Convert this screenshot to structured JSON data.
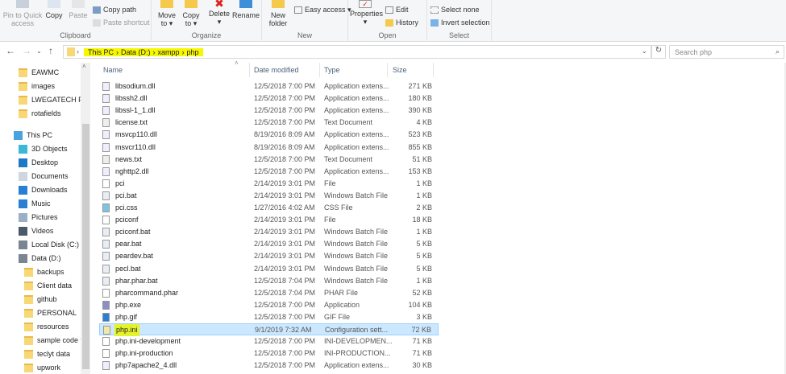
{
  "ribbon": {
    "clipboard": {
      "label": "Clipboard",
      "pin": "Pin to Quick access",
      "copy": "Copy",
      "paste": "Paste",
      "copy_path": "Copy path",
      "paste_shortcut": "Paste shortcut"
    },
    "organize": {
      "label": "Organize",
      "move_to": "Move to",
      "copy_to": "Copy to",
      "delete": "Delete",
      "rename": "Rename"
    },
    "new": {
      "label": "New",
      "new_folder": "New folder",
      "easy_access": "Easy access"
    },
    "open": {
      "label": "Open",
      "properties": "Properties",
      "edit": "Edit",
      "history": "History"
    },
    "select": {
      "label": "Select",
      "select_none": "Select none",
      "invert": "Invert selection"
    }
  },
  "address": {
    "crumbs": [
      "This PC",
      "Data  (D:)",
      "xampp",
      "php"
    ],
    "search_placeholder": "Search php",
    "highlight_color": "#f7f700"
  },
  "sidebar": {
    "items": [
      {
        "label": "EAWMC",
        "icon": "folder-icon",
        "indent": 1
      },
      {
        "label": "images",
        "icon": "folder-icon",
        "indent": 1
      },
      {
        "label": "LWEGATECH PO",
        "icon": "folder-icon",
        "indent": 1
      },
      {
        "label": "rotafields",
        "icon": "folder-icon",
        "indent": 1
      },
      {
        "label": "This PC",
        "icon": "computer-icon",
        "indent": 0
      },
      {
        "label": "3D Objects",
        "icon": "cube-icon",
        "indent": 1
      },
      {
        "label": "Desktop",
        "icon": "desktop-icon",
        "indent": 1
      },
      {
        "label": "Documents",
        "icon": "document-icon",
        "indent": 1
      },
      {
        "label": "Downloads",
        "icon": "download-icon",
        "indent": 1
      },
      {
        "label": "Music",
        "icon": "music-icon",
        "indent": 1
      },
      {
        "label": "Pictures",
        "icon": "pictures-icon",
        "indent": 1
      },
      {
        "label": "Videos",
        "icon": "videos-icon",
        "indent": 1
      },
      {
        "label": "Local Disk (C:)",
        "icon": "drive-icon",
        "indent": 1
      },
      {
        "label": "Data  (D:)",
        "icon": "drive-icon",
        "indent": 1
      },
      {
        "label": "backups",
        "icon": "folder-icon",
        "indent": 2
      },
      {
        "label": "Client data",
        "icon": "folder-icon",
        "indent": 2
      },
      {
        "label": "github",
        "icon": "folder-icon",
        "indent": 2
      },
      {
        "label": "PERSONAL",
        "icon": "folder-icon",
        "indent": 2
      },
      {
        "label": "resources",
        "icon": "folder-icon",
        "indent": 2
      },
      {
        "label": "sample code fc",
        "icon": "folder-icon",
        "indent": 2
      },
      {
        "label": "teclyt data",
        "icon": "folder-icon",
        "indent": 2
      },
      {
        "label": "upwork",
        "icon": "folder-icon",
        "indent": 2
      }
    ]
  },
  "columns": {
    "name": "Name",
    "date": "Date modified",
    "type": "Type",
    "size": "Size"
  },
  "files": [
    {
      "name": "libsodium.dll",
      "date": "12/5/2018 7:00 PM",
      "type": "Application extens...",
      "size": "271 KB",
      "icon": "dll-icon"
    },
    {
      "name": "libssh2.dll",
      "date": "12/5/2018 7:00 PM",
      "type": "Application extens...",
      "size": "180 KB",
      "icon": "dll-icon"
    },
    {
      "name": "libssl-1_1.dll",
      "date": "12/5/2018 7:00 PM",
      "type": "Application extens...",
      "size": "390 KB",
      "icon": "dll-icon"
    },
    {
      "name": "license.txt",
      "date": "12/5/2018 7:00 PM",
      "type": "Text Document",
      "size": "4 KB",
      "icon": "text-icon"
    },
    {
      "name": "msvcp110.dll",
      "date": "8/19/2016 8:09 AM",
      "type": "Application extens...",
      "size": "523 KB",
      "icon": "dll-icon"
    },
    {
      "name": "msvcr110.dll",
      "date": "8/19/2016 8:09 AM",
      "type": "Application extens...",
      "size": "855 KB",
      "icon": "dll-icon"
    },
    {
      "name": "news.txt",
      "date": "12/5/2018 7:00 PM",
      "type": "Text Document",
      "size": "51 KB",
      "icon": "text-icon"
    },
    {
      "name": "nghttp2.dll",
      "date": "12/5/2018 7:00 PM",
      "type": "Application extens...",
      "size": "153 KB",
      "icon": "dll-icon"
    },
    {
      "name": "pci",
      "date": "2/14/2019 3:01 PM",
      "type": "File",
      "size": "1 KB",
      "icon": "file-icon"
    },
    {
      "name": "pci.bat",
      "date": "2/14/2019 3:01 PM",
      "type": "Windows Batch File",
      "size": "1 KB",
      "icon": "batch-icon"
    },
    {
      "name": "pci.css",
      "date": "1/27/2016 4:02 AM",
      "type": "CSS File",
      "size": "2 KB",
      "icon": "css-icon"
    },
    {
      "name": "pciconf",
      "date": "2/14/2019 3:01 PM",
      "type": "File",
      "size": "18 KB",
      "icon": "file-icon"
    },
    {
      "name": "pciconf.bat",
      "date": "2/14/2019 3:01 PM",
      "type": "Windows Batch File",
      "size": "1 KB",
      "icon": "batch-icon"
    },
    {
      "name": "pear.bat",
      "date": "2/14/2019 3:01 PM",
      "type": "Windows Batch File",
      "size": "5 KB",
      "icon": "batch-icon"
    },
    {
      "name": "peardev.bat",
      "date": "2/14/2019 3:01 PM",
      "type": "Windows Batch File",
      "size": "5 KB",
      "icon": "batch-icon"
    },
    {
      "name": "pecl.bat",
      "date": "2/14/2019 3:01 PM",
      "type": "Windows Batch File",
      "size": "5 KB",
      "icon": "batch-icon"
    },
    {
      "name": "phar.phar.bat",
      "date": "12/5/2018 7:04 PM",
      "type": "Windows Batch File",
      "size": "1 KB",
      "icon": "batch-icon"
    },
    {
      "name": "pharcommand.phar",
      "date": "12/5/2018 7:04 PM",
      "type": "PHAR File",
      "size": "52 KB",
      "icon": "file-icon"
    },
    {
      "name": "php.exe",
      "date": "12/5/2018 7:00 PM",
      "type": "Application",
      "size": "104 KB",
      "icon": "php-exe-icon"
    },
    {
      "name": "php.gif",
      "date": "12/5/2018 7:00 PM",
      "type": "GIF File",
      "size": "3 KB",
      "icon": "image-icon"
    },
    {
      "name": "php.ini",
      "date": "9/1/2019 7:32 AM",
      "type": "Configuration sett...",
      "size": "72 KB",
      "icon": "config-icon",
      "selected": true,
      "highlighted": true
    },
    {
      "name": "php.ini-development",
      "date": "12/5/2018 7:00 PM",
      "type": "INI-DEVELOPMEN...",
      "size": "71 KB",
      "icon": "file-icon"
    },
    {
      "name": "php.ini-production",
      "date": "12/5/2018 7:00 PM",
      "type": "INI-PRODUCTION...",
      "size": "71 KB",
      "icon": "file-icon"
    },
    {
      "name": "php7apache2_4.dll",
      "date": "12/5/2018 7:00 PM",
      "type": "Application extens...",
      "size": "30 KB",
      "icon": "dll-icon"
    }
  ]
}
